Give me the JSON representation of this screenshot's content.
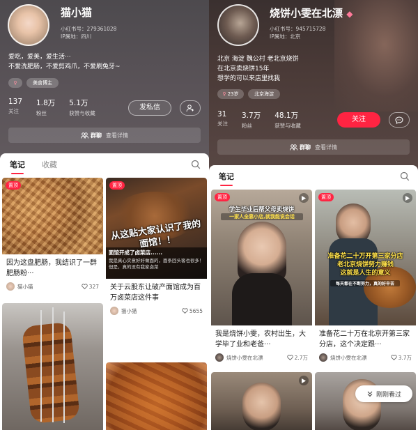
{
  "left": {
    "profile": {
      "name": "猫小猫",
      "id_text": "小红书号：279361028",
      "ip_text": "IP属地：四川",
      "bio": [
        "爱吃，爱美，爱生活···",
        "不爱洗肥肠，不爱剪鸡爪，不爱刷兔牙~"
      ],
      "tag": "美食博主",
      "stats": [
        {
          "num": "137",
          "label": "关注"
        },
        {
          "num": "1.8万",
          "label": "粉丝"
        },
        {
          "num": "5.1万",
          "label": "获赞与收藏"
        }
      ],
      "message_button": "发私信"
    },
    "group": {
      "name": "群聊",
      "more": "查看详情"
    },
    "tabs": [
      {
        "label": "笔记",
        "active": true
      },
      {
        "label": "收藏",
        "active": false
      }
    ],
    "cards": [
      {
        "pin": "置顶",
        "title": "因为这盘肥肠，我结识了一群肥肠粉···",
        "user": "猫小猫",
        "likes": "327"
      },
      {
        "pin": "置顶",
        "overlay": "从这贴大家认识了我的面馆！！",
        "caption_title": "面馆开成了卤菜店......",
        "caption_body": "我是真心实意好好做面的，面条回头客也很多！但是，真的没有我家卤菜",
        "title": "关于云股东让破产面馆成为百万卤菜店这件事",
        "user": "猫小猫",
        "likes": "5655"
      }
    ]
  },
  "right": {
    "profile": {
      "name": "烧饼小雯在北漂",
      "id_text": "小红书号：945715728",
      "ip_text": "IP属地：北京",
      "bio": [
        "北京 海淀 魏公村 老北京烧饼",
        "在北京卖烧饼15年",
        "想学的可以来店里找我"
      ],
      "tags": [
        "23岁",
        "北京海淀"
      ],
      "stats": [
        {
          "num": "31",
          "label": "关注"
        },
        {
          "num": "3.7万",
          "label": "粉丝"
        },
        {
          "num": "48.1万",
          "label": "获赞与收藏"
        }
      ],
      "follow_button": "关注"
    },
    "group": {
      "name": "群聊",
      "more": "查看详情"
    },
    "tabs": [
      {
        "label": "笔记",
        "active": true
      }
    ],
    "cards": [
      {
        "pin": "置顶",
        "overlay_top": "学生毕业后帮父母卖烧饼",
        "overlay_sub": "一家人全靠小店,就我能说会话",
        "title": "我是烧饼小雯，农村出生，大学毕了业和老爸···",
        "user": "烧饼小雯在北漂",
        "likes": "2.7万"
      },
      {
        "pin": "置顶",
        "overlay": "准备花二十万开第三家分店\n老北京烧饼努力赚钱\n这就是人生的意义",
        "overlay_small": "每天都在不断努力，真的好辛苦",
        "title": "准备花二十万在北京开第三家分店，这个决定跟···",
        "user": "烧饼小雯在北漂",
        "likes": "3.7万"
      }
    ],
    "back_pill": "刚刚看过"
  },
  "colors": {
    "accent": "#ff2442"
  }
}
